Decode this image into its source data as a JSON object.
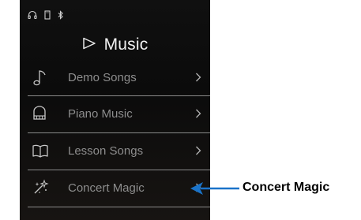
{
  "screen": {
    "status_icons": [
      "headphones-icon",
      "usb-icon",
      "bluetooth-icon"
    ],
    "title": "Music",
    "menu_items": [
      {
        "label": "Demo Songs",
        "icon": "music-note-icon"
      },
      {
        "label": "Piano Music",
        "icon": "piano-icon"
      },
      {
        "label": "Lesson Songs",
        "icon": "book-icon"
      },
      {
        "label": "Concert Magic",
        "icon": "magic-sparkles-icon"
      }
    ]
  },
  "annotation": {
    "label": "Concert Magic",
    "color": "#1a73c9"
  }
}
